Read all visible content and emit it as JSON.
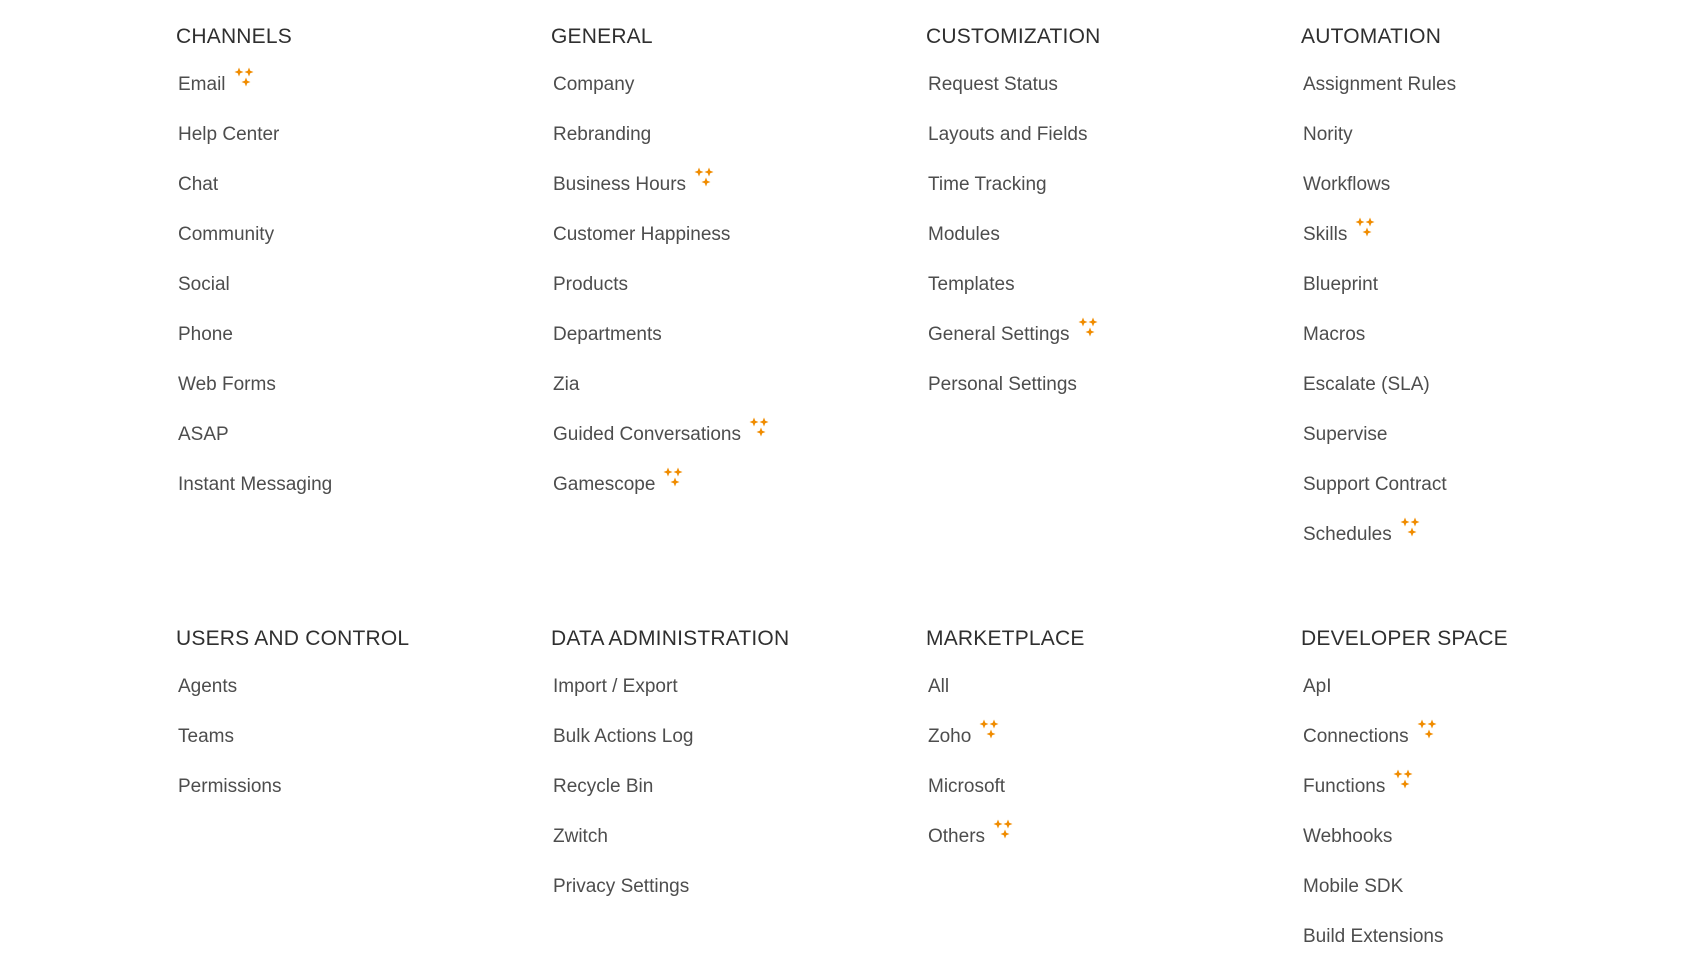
{
  "colors": {
    "heading": "#2f2f2f",
    "item_text": "#4d4d4d",
    "sparkle": "#f08c00",
    "background": "#ffffff"
  },
  "icons": {
    "new_feature": "sparkle-icon"
  },
  "sections": [
    {
      "title": "CHANNELS",
      "items": [
        {
          "label": "Email",
          "new": true
        },
        {
          "label": "Help Center",
          "new": false
        },
        {
          "label": "Chat",
          "new": false
        },
        {
          "label": "Community",
          "new": false
        },
        {
          "label": "Social",
          "new": false
        },
        {
          "label": "Phone",
          "new": false
        },
        {
          "label": "Web Forms",
          "new": false
        },
        {
          "label": "ASAP",
          "new": false
        },
        {
          "label": "Instant Messaging",
          "new": false
        }
      ]
    },
    {
      "title": "GENERAL",
      "items": [
        {
          "label": "Company",
          "new": false
        },
        {
          "label": "Rebranding",
          "new": false
        },
        {
          "label": "Business Hours",
          "new": true
        },
        {
          "label": "Customer Happiness",
          "new": false
        },
        {
          "label": "Products",
          "new": false
        },
        {
          "label": "Departments",
          "new": false
        },
        {
          "label": "Zia",
          "new": false
        },
        {
          "label": "Guided Conversations",
          "new": true
        },
        {
          "label": "Gamescope",
          "new": true
        }
      ]
    },
    {
      "title": "CUSTOMIZATION",
      "items": [
        {
          "label": "Request Status",
          "new": false
        },
        {
          "label": "Layouts and Fields",
          "new": false
        },
        {
          "label": "Time Tracking",
          "new": false
        },
        {
          "label": "Modules",
          "new": false
        },
        {
          "label": "Templates",
          "new": false
        },
        {
          "label": "General Settings",
          "new": true
        },
        {
          "label": "Personal Settings",
          "new": false
        }
      ]
    },
    {
      "title": "AUTOMATION",
      "items": [
        {
          "label": "Assignment Rules",
          "new": false
        },
        {
          "label": "Nority",
          "new": false
        },
        {
          "label": "Workflows",
          "new": false
        },
        {
          "label": "Skills",
          "new": true
        },
        {
          "label": "Blueprint",
          "new": false
        },
        {
          "label": "Macros",
          "new": false
        },
        {
          "label": "Escalate (SLA)",
          "new": false
        },
        {
          "label": "Supervise",
          "new": false
        },
        {
          "label": "Support Contract",
          "new": false
        },
        {
          "label": "Schedules",
          "new": true
        }
      ]
    },
    {
      "title": "USERS AND CONTROL",
      "items": [
        {
          "label": "Agents",
          "new": false
        },
        {
          "label": "Teams",
          "new": false
        },
        {
          "label": "Permissions",
          "new": false
        }
      ]
    },
    {
      "title": "DATA ADMINISTRATION",
      "items": [
        {
          "label": "Import / Export",
          "new": false
        },
        {
          "label": "Bulk Actions Log",
          "new": false
        },
        {
          "label": "Recycle Bin",
          "new": false
        },
        {
          "label": "Zwitch",
          "new": false
        },
        {
          "label": "Privacy Settings",
          "new": false
        }
      ]
    },
    {
      "title": "MARKETPLACE",
      "items": [
        {
          "label": "All",
          "new": false
        },
        {
          "label": "Zoho",
          "new": true
        },
        {
          "label": "Microsoft",
          "new": false
        },
        {
          "label": "Others",
          "new": true
        }
      ]
    },
    {
      "title": "DEVELOPER SPACE",
      "items": [
        {
          "label": "ApI",
          "new": false
        },
        {
          "label": "Connections",
          "new": true
        },
        {
          "label": "Functions",
          "new": true
        },
        {
          "label": "Webhooks",
          "new": false
        },
        {
          "label": "Mobile SDK",
          "new": false
        },
        {
          "label": "Build Extensions",
          "new": false
        }
      ]
    }
  ]
}
